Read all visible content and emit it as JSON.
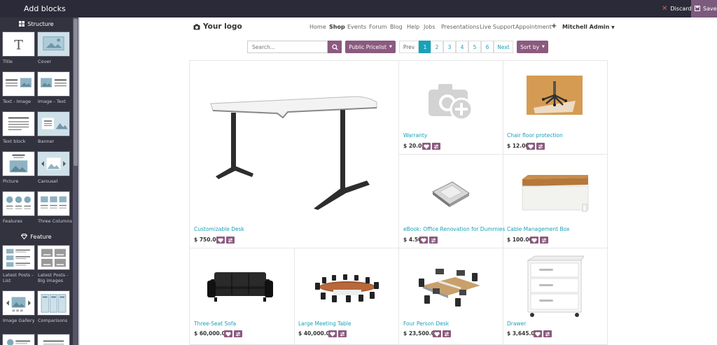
{
  "topbar": {
    "title": "Add blocks",
    "discard_label": "Discard",
    "save_label": "Save"
  },
  "sidebar": {
    "structure_title": "Structure",
    "feature_title": "Feature",
    "structure_items": [
      "Title",
      "Cover",
      "Text - Image",
      "Image - Text",
      "Text block",
      "Banner",
      "Picture",
      "Carousel",
      "Features",
      "Three Columns"
    ],
    "feature_items": [
      "Latest Posts - List",
      "Latest Posts - Big images",
      "Image Gallery",
      "Comparisons"
    ]
  },
  "site": {
    "logo": "Your logo",
    "nav": [
      "Home",
      "Shop",
      "Events",
      "Forum",
      "Blog",
      "Help",
      "Jobs",
      "Presentations",
      "Live Support",
      "Appointment"
    ],
    "plus": "+",
    "user": "Mitchell Admin"
  },
  "toolbar": {
    "search_placeholder": "Search...",
    "pricelist": "Public Pricelist",
    "prev": "Prev",
    "pages": [
      "1",
      "2",
      "3",
      "4",
      "5",
      "6"
    ],
    "next": "Next",
    "sort": "Sort by"
  },
  "products": [
    {
      "name": "Customizable Desk",
      "price": "$ 750.00"
    },
    {
      "name": "Warranty",
      "price": "$ 20.00"
    },
    {
      "name": "Chair floor protection",
      "price": "$ 12.00"
    },
    {
      "name": "eBook: Office Renovation for Dummies",
      "price": "$ 4.50"
    },
    {
      "name": "Cable Management Box",
      "price": "$ 100.00"
    },
    {
      "name": "Three-Seat Sofa",
      "price": "$ 60,000.00"
    },
    {
      "name": "Large Meeting Table",
      "price": "$ 40,000.00"
    },
    {
      "name": "Four Person Desk",
      "price": "$ 23,500.00"
    },
    {
      "name": "Drawer",
      "price": "$ 3,645.00"
    }
  ],
  "colors": {
    "accent": "#8b5a7f",
    "link": "#17a2b8",
    "topbar": "#2a2a38",
    "sidebar": "#33333f"
  }
}
